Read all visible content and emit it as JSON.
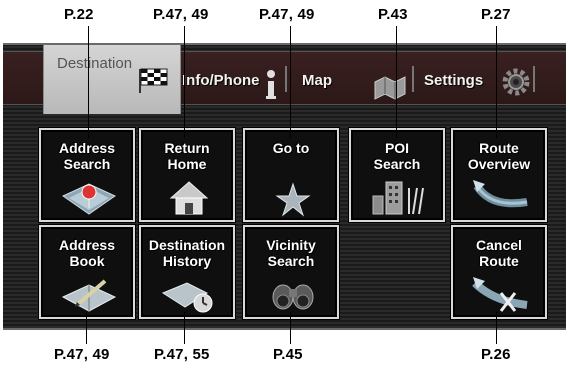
{
  "page_refs": {
    "destination_tab": "P.22",
    "return_home": "P.47, 49",
    "go_to": "P.47, 49",
    "poi_search": "P.43",
    "route_overview": "P.27",
    "address_book": "P.47, 49",
    "destination_history": "P.47, 55",
    "vicinity_search": "P.45",
    "cancel_route": "P.26"
  },
  "tabs": [
    {
      "label": "Destination",
      "active": true,
      "icon": "checkered-flag-icon"
    },
    {
      "label": "Info/Phone",
      "active": false,
      "icon": "info-icon"
    },
    {
      "label": "Map",
      "active": false,
      "icon": "map-icon"
    },
    {
      "label": "Settings",
      "active": false,
      "icon": "gear-icon"
    }
  ],
  "buttons": {
    "address_search": {
      "line1": "Address",
      "line2": "Search",
      "icon": "map-pin-icon"
    },
    "return_home": {
      "line1": "Return",
      "line2": "Home",
      "icon": "house-icon"
    },
    "go_to": {
      "line1": "Go to",
      "line2": "",
      "icon": "star-icon"
    },
    "poi_search": {
      "line1": "POI",
      "line2": "Search",
      "icon": "poi-icon"
    },
    "route_overview": {
      "line1": "Route",
      "line2": "Overview",
      "icon": "route-arrow-icon"
    },
    "address_book": {
      "line1": "Address",
      "line2": "Book",
      "icon": "book-pencil-icon"
    },
    "destination_history": {
      "line1": "Destination",
      "line2": "History",
      "icon": "history-clock-icon"
    },
    "vicinity_search": {
      "line1": "Vicinity",
      "line2": "Search",
      "icon": "binoculars-icon"
    },
    "cancel_route": {
      "line1": "Cancel",
      "line2": "Route",
      "icon": "cancel-route-icon"
    }
  },
  "colors": {
    "screen_bg": "#1d1d1d",
    "tabbar_bg": "#2c1818",
    "active_tab": "#cfcfcf",
    "button_border": "#d8d8d8"
  }
}
